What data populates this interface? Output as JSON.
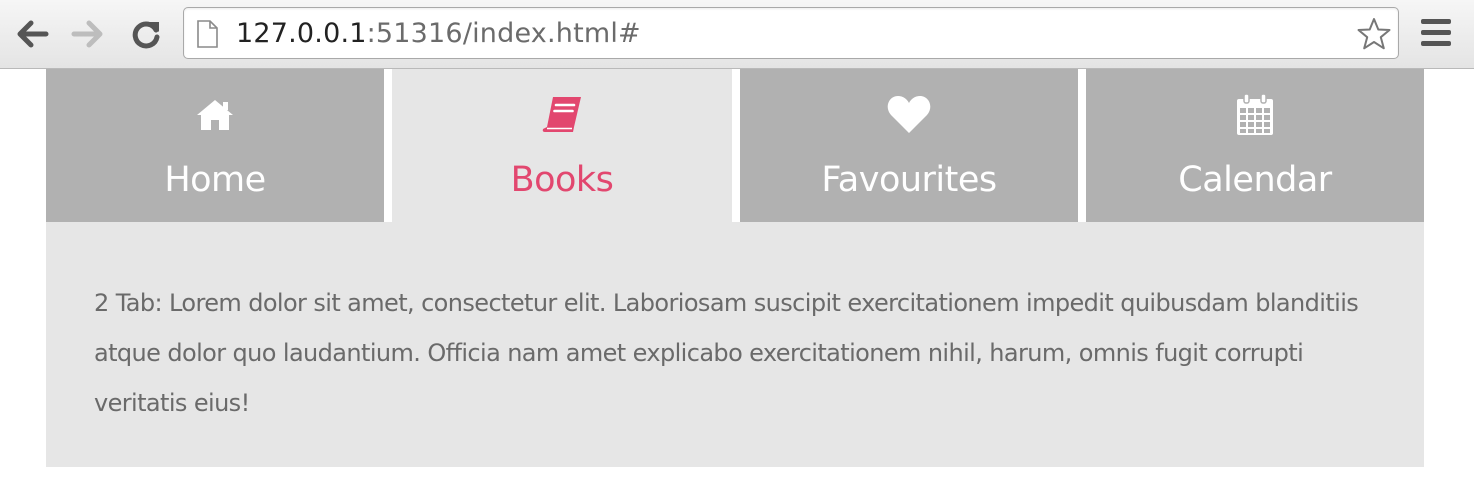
{
  "browser": {
    "url_host": "127.0.0.1",
    "url_rest": ":51316/index.html#",
    "icons": {
      "back": "back-arrow-icon",
      "forward": "forward-arrow-icon",
      "reload": "reload-icon",
      "page": "page-icon",
      "bookmark": "star-icon",
      "menu": "hamburger-menu-icon"
    }
  },
  "tabs": [
    {
      "label": "Home",
      "icon": "home-icon",
      "active": false
    },
    {
      "label": "Books",
      "icon": "book-icon",
      "active": true
    },
    {
      "label": "Favourites",
      "icon": "heart-icon",
      "active": false
    },
    {
      "label": "Calendar",
      "icon": "calendar-icon",
      "active": false
    }
  ],
  "panel": {
    "text": "2 Tab: Lorem dolor sit amet, consectetur elit. Laboriosam suscipit exercitationem impedit quibusdam blanditiis atque dolor quo laudantium. Officia nam amet explicabo exercitationem nihil, harum, omnis fugit corrupti veritatis eius!"
  },
  "colors": {
    "tab_inactive_bg": "#b1b1b1",
    "tab_active_bg": "#e6e6e6",
    "accent": "#e2476f",
    "text": "#6a6a6a"
  }
}
